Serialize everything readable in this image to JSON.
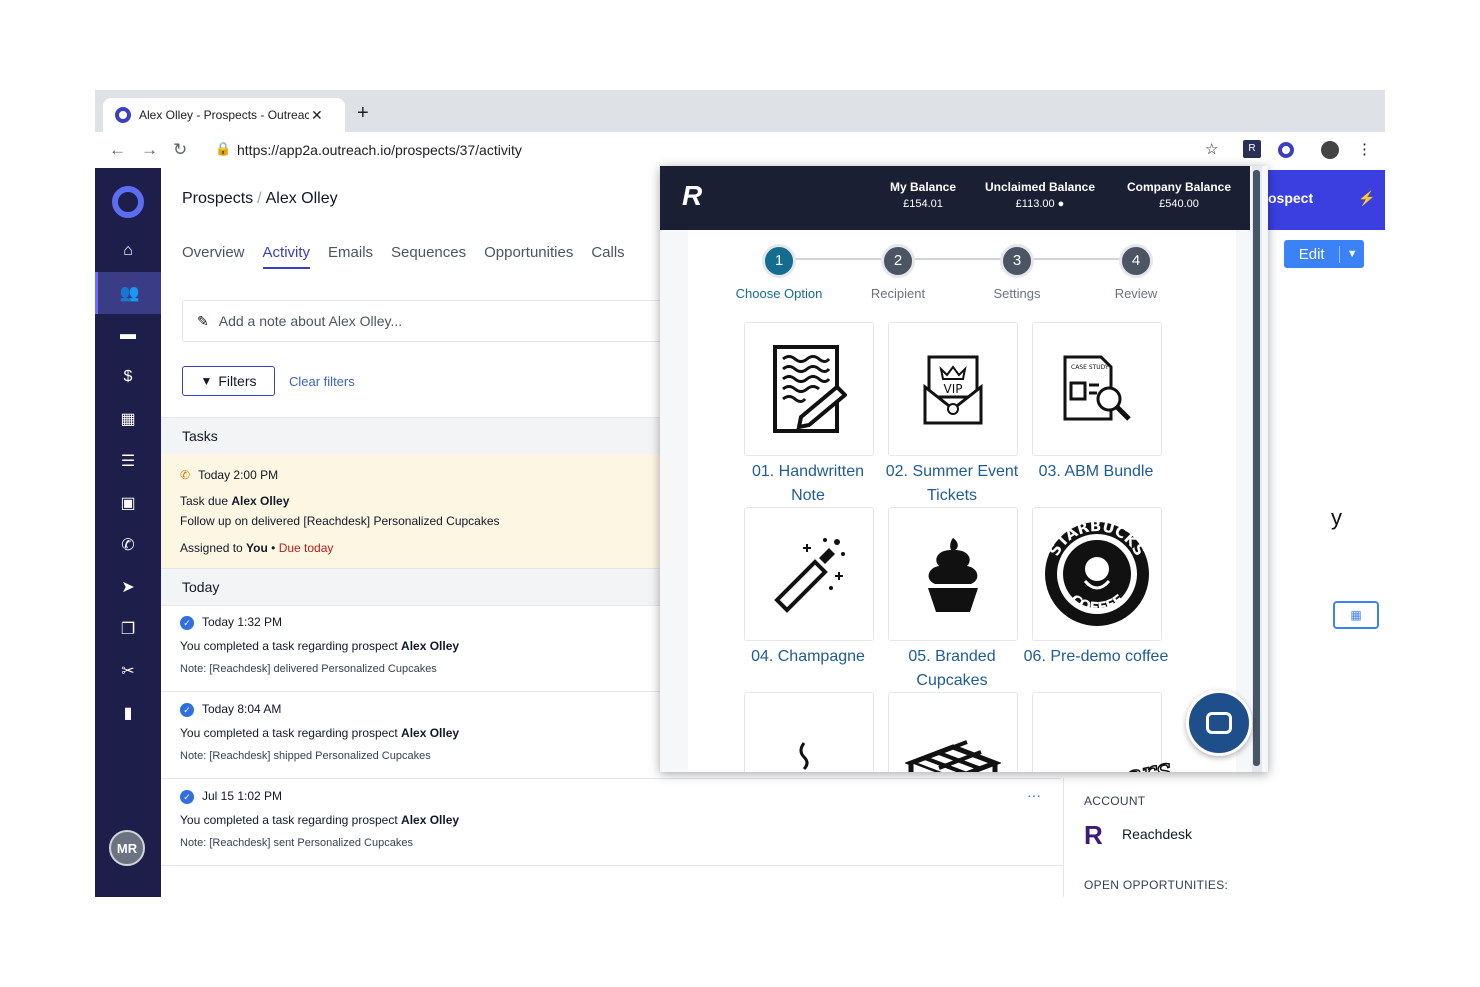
{
  "browser": {
    "tab_title": "Alex Olley - Prospects - Outreach",
    "new_tab": "+",
    "close_tab": "✕",
    "url": "https://app2a.outreach.io/prospects/37/activity"
  },
  "rail": {
    "avatar_initials": "MR"
  },
  "breadcrumb": {
    "section": "Prospects",
    "separator": "/",
    "name": "Alex Olley"
  },
  "tabs": [
    "Overview",
    "Activity",
    "Emails",
    "Sequences",
    "Opportunities",
    "Calls"
  ],
  "note_placeholder": "Add a note about Alex Olley...",
  "filters": {
    "button": "Filters",
    "clear": "Clear filters"
  },
  "tasks": {
    "header": "Tasks",
    "item": {
      "time": "Today 2:00 PM",
      "due_prefix": "Task due ",
      "due_name": "Alex Olley",
      "description": "Follow up on delivered [Reachdesk] Personalized Cupcakes",
      "assigned_prefix": "Assigned to ",
      "assigned_to": "You",
      "bullet": " • ",
      "due_status": "Due today"
    }
  },
  "today_header": "Today",
  "activities": [
    {
      "time": "Today 1:32 PM",
      "text": "You completed a task regarding prospect ",
      "name": "Alex Olley",
      "note": "Note: [Reachdesk] delivered Personalized Cupcakes"
    },
    {
      "time": "Today 8:04 AM",
      "text": "You completed a task regarding prospect ",
      "name": "Alex Olley",
      "note": "Note: [Reachdesk] shipped Personalized Cupcakes"
    },
    {
      "time": "Jul 15 1:02 PM",
      "text": "You completed a task regarding prospect ",
      "name": "Alex Olley",
      "note": "Note: [Reachdesk] sent Personalized Cupcakes"
    }
  ],
  "more": "···",
  "side": {
    "account_label": "ACCOUNT",
    "account_name": "Reachdesk",
    "opps_label": "OPEN OPPORTUNITIES:",
    "cta": "ospect",
    "edit": "Edit",
    "yfrag": "y"
  },
  "reachdesk": {
    "balances": [
      {
        "label": "My Balance",
        "value": "£154.01"
      },
      {
        "label": "Unclaimed Balance",
        "value": "£113.00 ●"
      },
      {
        "label": "Company Balance",
        "value": "£540.00"
      }
    ],
    "steps": [
      {
        "num": "1",
        "label": "Choose Option"
      },
      {
        "num": "2",
        "label": "Recipient"
      },
      {
        "num": "3",
        "label": "Settings"
      },
      {
        "num": "4",
        "label": "Review"
      }
    ],
    "options": [
      "01. Handwritten Note",
      "02. Summer Event Tickets",
      "03. ABM Bundle",
      "04. Champagne",
      "05. Branded Cupcakes",
      "06. Pre-demo coffee"
    ],
    "vip_text": "VIP",
    "case_text": "CASE STUDY",
    "starbucks_top": "STARBUCKS",
    "starbucks_bottom": "COFFEE",
    "maltesers": "Maltesers"
  },
  "colors": {
    "rail": "#1e1e4b",
    "accent": "#3b3fbf",
    "reachdesk_header": "#1b1f33",
    "step_active": "#146c8f",
    "caption": "#1f5c94",
    "task_bg": "#fdf6e3",
    "due": "#b91c1c"
  }
}
